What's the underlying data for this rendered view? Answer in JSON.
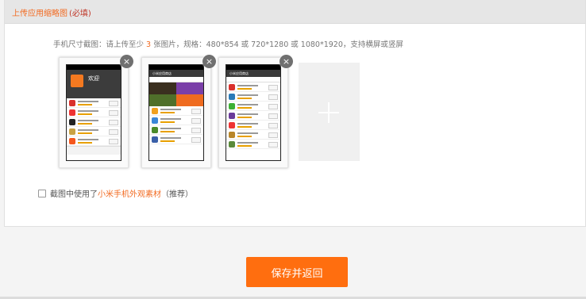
{
  "panel": {
    "title": "上传应用缩略图",
    "required_tag": "(必填)"
  },
  "hint": {
    "prefix": "手机尺寸截图：请上传至少",
    "min_count": "3",
    "suffix": "张图片，规格：480*854 或 720*1280 或 1080*1920，支持横屏或竖屏"
  },
  "screenshots": [
    {
      "close_symbol": "×",
      "title": "欢迎"
    },
    {
      "close_symbol": "×",
      "title": "小米应用商店"
    },
    {
      "close_symbol": "×",
      "title": "小米应用商店"
    }
  ],
  "add_box": {
    "icon": "plus-icon"
  },
  "checkbox": {
    "checked": false,
    "label_before": "截图中使用了",
    "link_text": "小米手机外观素材",
    "label_after": "（推荐）"
  },
  "save_button": {
    "label": "保存并返回"
  },
  "colors": {
    "accent": "#f26b22",
    "button": "#ff6e0f"
  }
}
